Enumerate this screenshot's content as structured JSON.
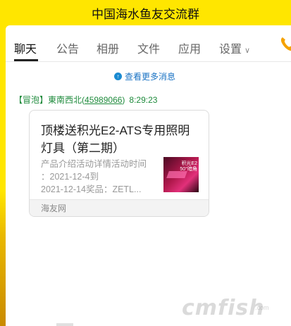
{
  "window": {
    "title": "中国海水鱼友交流群"
  },
  "tabs": [
    {
      "label": "聊天",
      "active": true
    },
    {
      "label": "公告",
      "active": false
    },
    {
      "label": "相册",
      "active": false
    },
    {
      "label": "文件",
      "active": false
    },
    {
      "label": "应用",
      "active": false
    },
    {
      "label": "设置",
      "active": false
    }
  ],
  "settings_chevron": "∨",
  "more_messages": {
    "label": "查看更多消息",
    "icon": "info-icon"
  },
  "message": {
    "badge": "【冒泡】",
    "sender": "東南西北",
    "uid_open": "(",
    "uid": "45989066",
    "uid_close": ")",
    "time": "8:29:23"
  },
  "card": {
    "title": "顶楼送积光E2-ATS专用照明灯具（第二期）",
    "description": "产品介绍活动详情活动时间\n：2021-12-4到\n2021-12-14奖品：ZETL...",
    "thumb_text_1": "积光E2",
    "thumb_text_2": "50°暗角",
    "source": "海友网"
  },
  "watermark": {
    "main": "cmfish",
    "sub": ".com"
  },
  "colors": {
    "title_bar": "#ffe600",
    "link": "#1a73c4",
    "sender": "#1d8a3b",
    "phone_icon": "#f5a200"
  }
}
